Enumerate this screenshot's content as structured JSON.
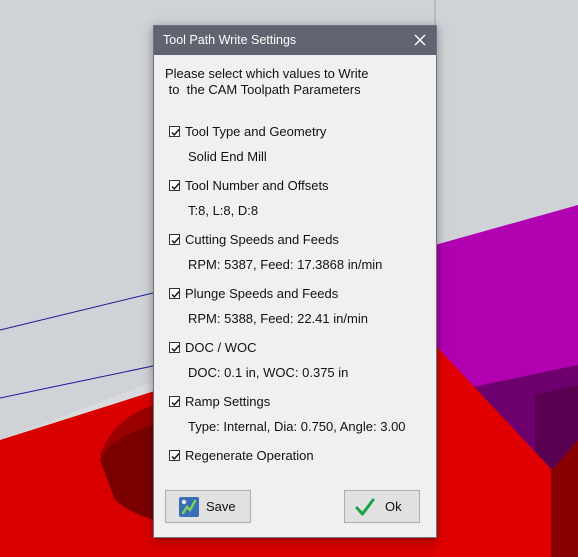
{
  "dialog": {
    "title": "Tool Path Write Settings",
    "intro": "Please select which values to Write\n to  the CAM Toolpath Parameters",
    "options": [
      {
        "label": "Tool Type and Geometry",
        "checked": true,
        "detail": "Solid End Mill"
      },
      {
        "label": "Tool Number and Offsets",
        "checked": true,
        "detail": "T:8, L:8, D:8"
      },
      {
        "label": "Cutting Speeds and Feeds",
        "checked": true,
        "detail": "RPM: 5387, Feed: 17.3868 in/min"
      },
      {
        "label": "Plunge Speeds and Feeds",
        "checked": true,
        "detail": "RPM: 5388, Feed: 22.41 in/min"
      },
      {
        "label": "DOC / WOC",
        "checked": true,
        "detail": "DOC: 0.1 in, WOC: 0.375 in"
      },
      {
        "label": "Ramp Settings",
        "checked": true,
        "detail": "Type: Internal, Dia:  0.750, Angle: 3.00"
      },
      {
        "label": "Regenerate Operation",
        "checked": true
      }
    ],
    "buttons": {
      "save": "Save",
      "ok": "Ok"
    },
    "icons": {
      "close": "close-icon",
      "save": "save-icon",
      "ok": "checkmark-icon"
    }
  },
  "colors": {
    "part_red": "#d90000",
    "part_magenta": "#b000b0",
    "titlebar": "#5f6470",
    "ok_check": "#1aa34a"
  }
}
